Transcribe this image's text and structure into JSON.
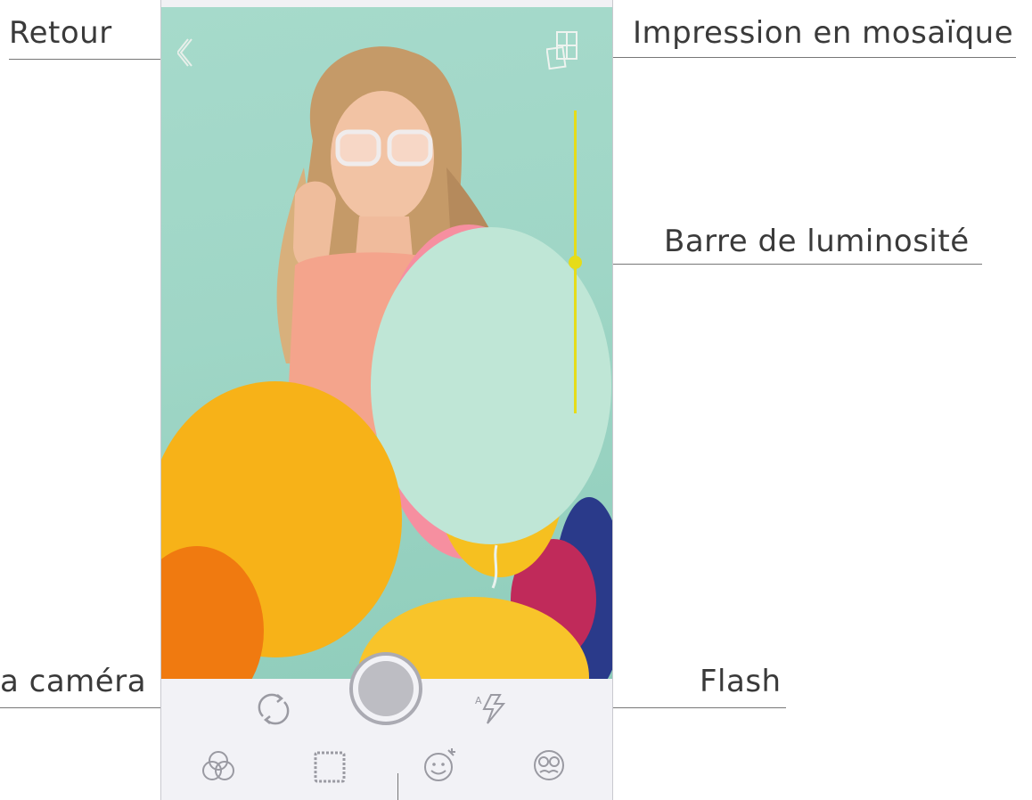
{
  "callouts": {
    "back": "Retour",
    "mosaic": "Impression en mosaïque",
    "brightness": "Barre de luminosité",
    "camera": "a caméra",
    "flash": "Flash"
  },
  "camera_screen": {
    "brightness_level": 0.5,
    "accent_color": "#e6dc19",
    "icons": {
      "back": "chevron-left-icon",
      "mosaic": "tile-grid-icon",
      "switch_camera": "rotate-camera-icon",
      "shutter": "shutter-button",
      "flash": "flash-auto-icon",
      "filters": "color-filter-icon",
      "frames": "frame-border-icon",
      "stickers": "sticker-smiley-icon",
      "face_mask": "face-mask-icon"
    }
  }
}
